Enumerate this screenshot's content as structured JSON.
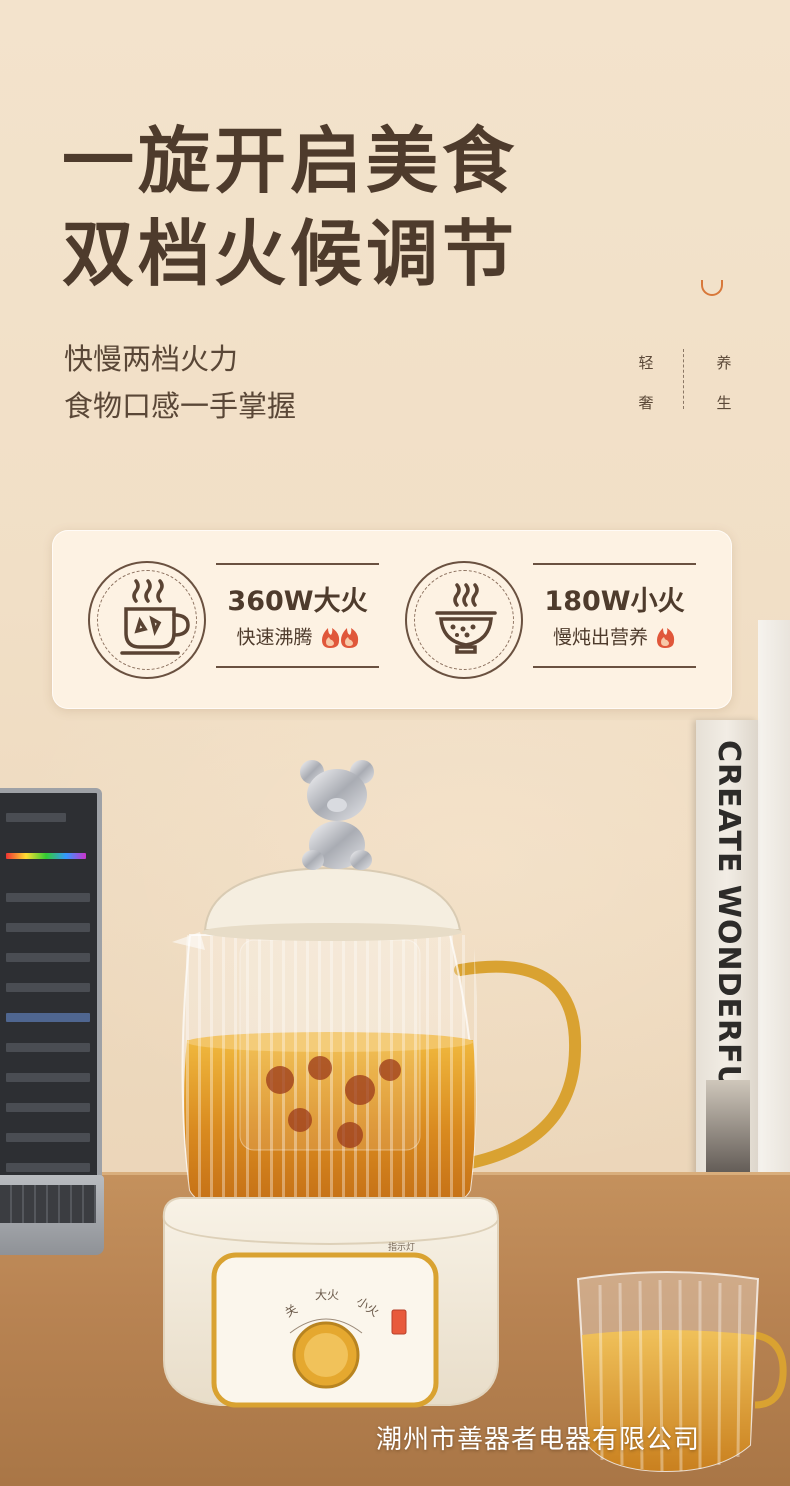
{
  "header": {
    "title_line1": "一旋开启美食",
    "title_line2": "双档火候调节",
    "subtitle_line1": "快慢两档火力",
    "subtitle_line2": "食物口感一手掌握",
    "side_vertical_left": "轻奢",
    "side_vertical_right": "养生"
  },
  "features": [
    {
      "power": "360W大火",
      "desc": "快速沸腾",
      "icon": "steaming-cup-icon",
      "flames": 2
    },
    {
      "power": "180W小火",
      "desc": "慢炖出营养",
      "icon": "steaming-bowl-icon",
      "flames": 1
    }
  ],
  "product": {
    "dial_labels": [
      "关",
      "大火",
      "小火"
    ],
    "indicator_label": "指示灯"
  },
  "book_title": "CREATE WONDERFUL HOMELIFE",
  "watermark": "潮州市善器者电器有限公司",
  "colors": {
    "title": "#4e3b2c",
    "accent": "#d8783a",
    "flame": "#e0573a",
    "panel": "#fdf2e3",
    "kettle_base": "#f4ecdc",
    "gold": "#d9a231"
  }
}
